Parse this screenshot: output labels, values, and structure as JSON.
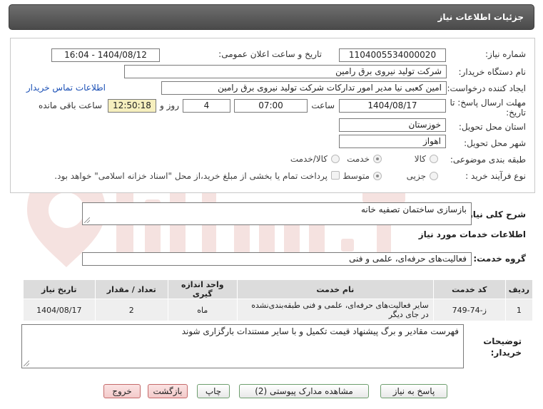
{
  "header": {
    "title": "جزئیات اطلاعات نیاز"
  },
  "fields": {
    "need_number_label": "شماره نیاز:",
    "need_number": "1104005534000020",
    "announce_label": "تاریخ و ساعت اعلان عمومی:",
    "announce_value": "1404/08/12 - 16:04",
    "buyer_org_label": "نام دستگاه خریدار:",
    "buyer_org": "شرکت تولید نیروی برق رامین",
    "creator_label": "ایجاد کننده درخواست:",
    "creator": "امین کعبی نیا مدیر امور تدارکات شرکت تولید نیروی برق رامین",
    "contact_link": "اطلاعات تماس خریدار",
    "deadline_label_1": "مهلت ارسال پاسخ: تا",
    "deadline_label_2": "تاریخ:",
    "deadline_date": "1404/08/17",
    "time_label": "ساعت",
    "deadline_time": "07:00",
    "days": "4",
    "days_label": "روز و",
    "remaining_time": "12:50:18",
    "remaining_label": "ساعت باقی مانده",
    "province_label": "استان محل تحویل:",
    "province": "خوزستان",
    "city_label": "شهر محل تحویل:",
    "city": "اهواز",
    "category_label": "طبقه بندی موضوعی:",
    "category_options": [
      "کالا",
      "خدمت",
      "کالا/خدمت"
    ],
    "category_selected": "خدمت",
    "process_label": "نوع فرآیند خرید :",
    "process_options": [
      "جزیی",
      "متوسط"
    ],
    "process_selected": "متوسط",
    "payment_note": "پرداخت تمام یا بخشی از مبلغ خرید،از محل \"اسناد خزانه اسلامی\" خواهد بود."
  },
  "summary": {
    "label": "شرح کلی نیاز:",
    "value": "بازسازی ساختمان تصفیه خانه"
  },
  "services_section": {
    "title": "اطلاعات خدمات مورد نیاز",
    "group_label": "گروه خدمت:",
    "group_value": "فعالیت‌های حرفه‌ای، علمی و فنی"
  },
  "table": {
    "headers": [
      "ردیف",
      "کد خدمت",
      "نام خدمت",
      "واحد اندازه گیری",
      "تعداد / مقدار",
      "تاریخ نیاز"
    ],
    "rows": [
      [
        "1",
        "ز-74-749",
        "سایر فعالیت‌های حرفه‌ای، علمی و فنی طبقه‌بندی‌نشده در جای دیگر",
        "ماه",
        "2",
        "1404/08/17"
      ]
    ]
  },
  "buyer_notes": {
    "label_1": "توضیحات",
    "label_2": "خریدار:",
    "value": "فهرست مقادیر و برگ پیشنهاد قیمت تکمیل و با سایر مستندات بارگزاری شوند"
  },
  "buttons": {
    "reply": "پاسخ به نیاز",
    "docs": "مشاهده مدارک پیوستی (2)",
    "print": "چاپ",
    "back": "بازگشت",
    "exit": "خروج"
  },
  "colors": {
    "header_bg": "#5a5a5a",
    "link": "#1a4fb5",
    "remaining_bg": "#f6efbe"
  }
}
